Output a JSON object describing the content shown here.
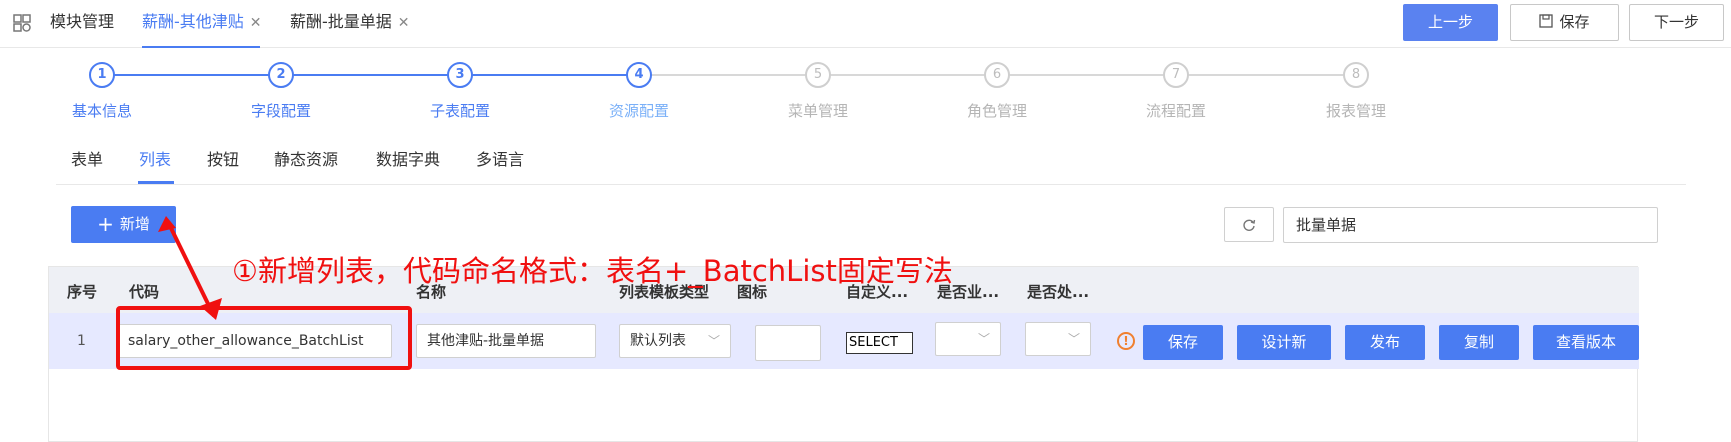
{
  "top_tabs": [
    {
      "label": "模块管理",
      "closable": false,
      "active": false
    },
    {
      "label": "薪酬-其他津贴",
      "closable": true,
      "active": true
    },
    {
      "label": "薪酬-批量单据",
      "closable": true,
      "active": false
    }
  ],
  "tab_close_glyph": "✕",
  "header_buttons": {
    "prev": "上一步",
    "save": "保存",
    "next": "下一步"
  },
  "steps": [
    {
      "number": "1",
      "label": "基本信息",
      "state": "done"
    },
    {
      "number": "2",
      "label": "字段配置",
      "state": "done"
    },
    {
      "number": "3",
      "label": "子表配置",
      "state": "done"
    },
    {
      "number": "4",
      "label": "资源配置",
      "state": "current"
    },
    {
      "number": "5",
      "label": "菜单管理",
      "state": "pending"
    },
    {
      "number": "6",
      "label": "角色管理",
      "state": "pending"
    },
    {
      "number": "7",
      "label": "流程配置",
      "state": "pending"
    },
    {
      "number": "8",
      "label": "报表管理",
      "state": "pending"
    }
  ],
  "sub_tabs": [
    {
      "label": "表单",
      "active": false
    },
    {
      "label": "列表",
      "active": true
    },
    {
      "label": "按钮",
      "active": false
    },
    {
      "label": "静态资源",
      "active": false
    },
    {
      "label": "数据字典",
      "active": false
    },
    {
      "label": "多语言",
      "active": false
    }
  ],
  "toolbar": {
    "add_label": "新增",
    "add_icon": "plus-icon",
    "refresh_icon": "refresh-icon",
    "search_value": "批量单据"
  },
  "table": {
    "headers": [
      "序号",
      "代码",
      "名称",
      "列表模板类型",
      "图标",
      "自定义...",
      "是否业...",
      "是否处..."
    ],
    "row": {
      "index": "1",
      "code": "salary_other_allowance_BatchList",
      "name": "其他津贴-批量单据",
      "template_type": "默认列表",
      "icon": "",
      "custom": "SELECT",
      "is_business": "",
      "is_process": ""
    },
    "row_buttons": [
      "保存",
      "设计新",
      "发布",
      "复制",
      "查看版本"
    ],
    "warn_glyph": "!"
  },
  "annotation": {
    "text": "①新增列表，代码命名格式：表名+_BatchList固定写法",
    "color": "#f01010"
  },
  "colors": {
    "primary": "#4a7cf2",
    "row_highlight": "#e6e9ff",
    "header_bg": "#eef0f5",
    "annotation": "#f01010"
  }
}
